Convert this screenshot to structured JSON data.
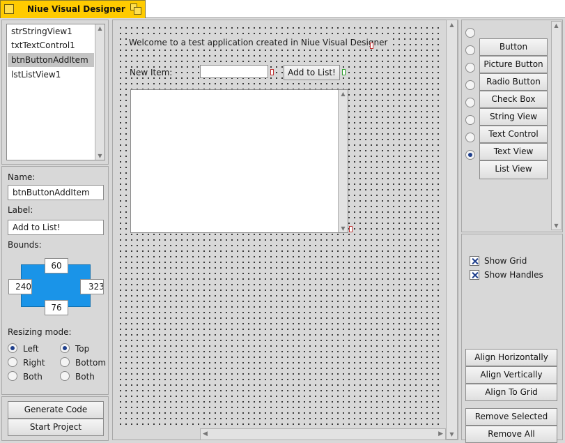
{
  "window": {
    "title": "Niue Visual Designer"
  },
  "objects": {
    "items": [
      "strStringView1",
      "txtTextControl1",
      "btnButtonAddItem",
      "lstListView1"
    ],
    "selected_index": 2
  },
  "properties": {
    "name_label": "Name:",
    "name_value": "btnButtonAddItem",
    "label_label": "Label:",
    "label_value": "Add to List!",
    "bounds_label": "Bounds:",
    "bounds": {
      "top": "60",
      "left": "240",
      "right": "323",
      "bottom": "76"
    },
    "resizing_label": "Resizing mode:",
    "horizontal": [
      "Left",
      "Right",
      "Both"
    ],
    "vertical": [
      "Top",
      "Bottom",
      "Both"
    ],
    "horizontal_selected": 0,
    "vertical_selected": 0
  },
  "actions": {
    "generate": "Generate Code",
    "start": "Start Project"
  },
  "canvas": {
    "welcome_text": "Welcome to a test application created in Niue Visual Designer",
    "new_item_label": "New Item:",
    "new_item_value": "",
    "add_button": "Add to List!"
  },
  "palette": {
    "items": [
      "Button",
      "Picture Button",
      "Radio Button",
      "Check Box",
      "String View",
      "Text Control",
      "Text View",
      "List View"
    ],
    "selected_index": 6
  },
  "options": {
    "show_grid": "Show Grid",
    "show_handles": "Show Handles",
    "show_grid_checked": true,
    "show_handles_checked": true
  },
  "align": {
    "horizontal": "Align Horizontally",
    "vertical": "Align Vertically",
    "grid": "Align To Grid"
  },
  "remove": {
    "selected": "Remove Selected",
    "all": "Remove All"
  },
  "colors": {
    "tab": "#ffcb00",
    "bounds": "#1a94e8",
    "accent": "#1f3f8c"
  }
}
